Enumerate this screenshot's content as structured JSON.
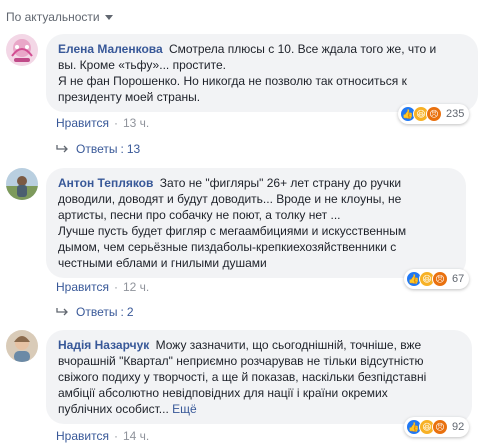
{
  "sort": {
    "label": "По актуальности"
  },
  "comments": [
    {
      "author": "Елена Маленкова",
      "lines": [
        "Смотрела плюсы с 10. Все ждала того же, что и",
        "вы. Кроме «тьфу»... простите.",
        "Я не фан Порошенко. Но никогда не позволю так относиться к",
        "президенту моей страны."
      ],
      "reactions": [
        "like",
        "haha",
        "angry"
      ],
      "reaction_count": "235",
      "like_label": "Нравится",
      "time": "13 ч.",
      "replies_label": "Ответы",
      "replies_count": "13"
    },
    {
      "author": "Антон Тепляков",
      "lines": [
        "Зато не \"фигляры\" 26+ лет страну до ручки",
        "доводили, доводят и будут доводить... Вроде и не клоуны, не",
        "артисты, песни про собачку не поют, а толку нет ...",
        "Лучше пусть будет фигляр с мегаамбициями и искусственным",
        "дымом, чем серьёзные пиздаболы-крепкиехозяйственники с",
        "честными еблами и гнилыми душами"
      ],
      "reactions": [
        "like",
        "haha",
        "angry"
      ],
      "reaction_count": "67",
      "like_label": "Нравится",
      "time": "12 ч.",
      "replies_label": "Ответы",
      "replies_count": "2"
    },
    {
      "author": "Надія Назарчук",
      "lines": [
        "Можу зазначити, що сьогоднішній, точніше, вже",
        "вчорашній \"Квартал\" неприємно розчарував не тільки відсутністю",
        "свіжого подиху у творчості, а ще й показав, наскільки безпідставні",
        "амбіції абсолютно невідповідних для нації і країни окремих",
        "публічних особист..."
      ],
      "more_label": "Ещё",
      "reactions": [
        "like",
        "haha",
        "angry"
      ],
      "reaction_count": "92",
      "like_label": "Нравится",
      "time": "14 ч."
    }
  ]
}
